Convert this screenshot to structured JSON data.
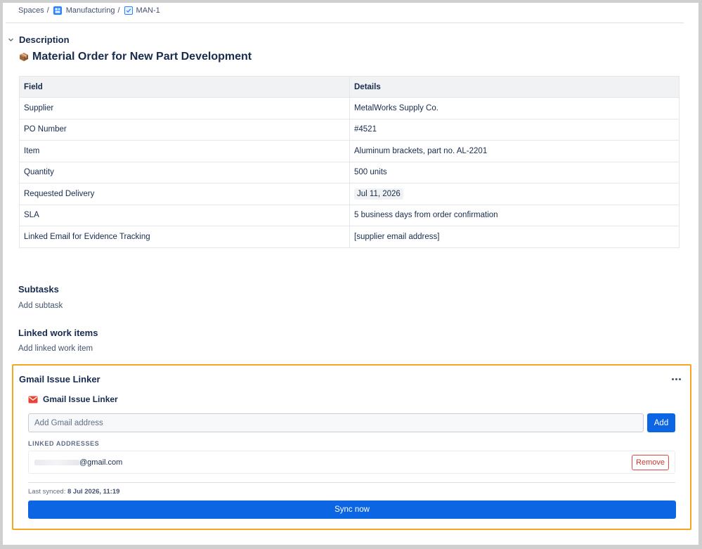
{
  "breadcrumb": {
    "spaces": "Spaces",
    "separator": "/",
    "project": "Manufacturing",
    "issue": "MAN-1",
    "project_icon": "project-board-icon",
    "issue_icon": "task-checkbox-icon"
  },
  "description": {
    "label": "Description",
    "title": "Material Order for New Part Development",
    "title_icon": "package-box-icon",
    "table": {
      "headers": [
        "Field",
        "Details"
      ],
      "rows": [
        [
          "Supplier",
          "MetalWorks Supply Co."
        ],
        [
          "PO Number",
          "#4521"
        ],
        [
          "Item",
          "Aluminum brackets, part no. AL-2201"
        ],
        [
          "Quantity",
          "500 units"
        ],
        [
          "Requested Delivery",
          "Jul 11, 2026"
        ],
        [
          "SLA",
          "5 business days from order confirmation"
        ],
        [
          "Linked Email for Evidence Tracking",
          "[supplier email address]"
        ]
      ]
    }
  },
  "subtasks": {
    "title": "Subtasks",
    "add_label": "Add subtask"
  },
  "linked_items": {
    "title": "Linked work items",
    "add_label": "Add linked work item"
  },
  "gmail_linker": {
    "panel_title": "Gmail Issue Linker",
    "app_title": "Gmail Issue Linker",
    "app_icon": "gmail-envelope-icon",
    "input_placeholder": "Add Gmail address",
    "add_label": "Add",
    "linked_label": "LINKED ADDRESSES",
    "addresses": [
      {
        "visible_text": "@gmail.com",
        "remove_label": "Remove"
      }
    ],
    "last_synced_label": "Last synced:",
    "last_synced_value": "8 Jul 2026, 11:19",
    "sync_label": "Sync now"
  },
  "colors": {
    "accent": "#0c66e4",
    "highlight_border": "#f5a623",
    "danger": "#c9372c"
  }
}
